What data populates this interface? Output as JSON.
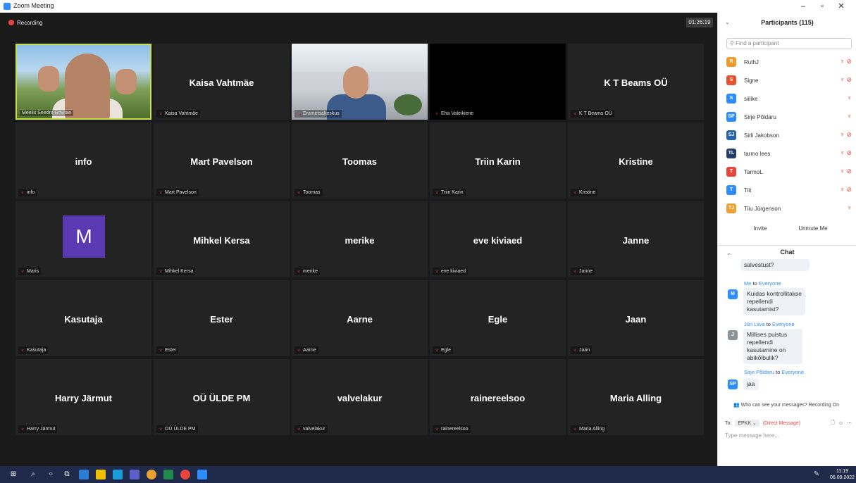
{
  "window": {
    "title": "Zoom Meeting"
  },
  "meeting": {
    "recording_label": "Recording",
    "timer": "01:26:19"
  },
  "tiles": [
    {
      "name": "",
      "label": "Meelis Seedre Brivitae",
      "kind": "video1"
    },
    {
      "name": "Kaisa Vahtmäe",
      "label": "Kaisa Vahtmäe",
      "kind": "name"
    },
    {
      "name": "",
      "label": "Erametsakeskus",
      "kind": "video2"
    },
    {
      "name": "",
      "label": "Eha Valeikiene",
      "kind": "black"
    },
    {
      "name": "K T Beams OÜ",
      "label": "K T Beams OÜ",
      "kind": "name"
    },
    {
      "name": "info",
      "label": "info",
      "kind": "name"
    },
    {
      "name": "Mart Pavelson",
      "label": "Mart Pavelson",
      "kind": "name"
    },
    {
      "name": "Toomas",
      "label": "Toomas",
      "kind": "name"
    },
    {
      "name": "Triin Karin",
      "label": "Triin Karin",
      "kind": "name"
    },
    {
      "name": "Kristine",
      "label": "Kristine",
      "kind": "name"
    },
    {
      "name": "M",
      "label": "Maris",
      "kind": "avatar"
    },
    {
      "name": "Mihkel Kersa",
      "label": "Mihkel Kersa",
      "kind": "name"
    },
    {
      "name": "merike",
      "label": "merike",
      "kind": "name"
    },
    {
      "name": "eve kiviaed",
      "label": "eve kiviaed",
      "kind": "name"
    },
    {
      "name": "Janne",
      "label": "Janne",
      "kind": "name"
    },
    {
      "name": "Kasutaja",
      "label": "Kasutaja",
      "kind": "name"
    },
    {
      "name": "Ester",
      "label": "Ester",
      "kind": "name"
    },
    {
      "name": "Aarne",
      "label": "Aarne",
      "kind": "name"
    },
    {
      "name": "Egle",
      "label": "Egle",
      "kind": "name"
    },
    {
      "name": "Jaan",
      "label": "Jaan",
      "kind": "name"
    },
    {
      "name": "Harry Järmut",
      "label": "Harry Järmut",
      "kind": "name"
    },
    {
      "name": "OÜ ÜLDE PM",
      "label": "OÜ ÜLDE PM",
      "kind": "name"
    },
    {
      "name": "valvelakur",
      "label": "valvelakur",
      "kind": "name"
    },
    {
      "name": "rainereelsoo",
      "label": "rainereelsoo",
      "kind": "name"
    },
    {
      "name": "Maria Alling",
      "label": "Maria Alling",
      "kind": "name"
    }
  ],
  "participants": {
    "title": "Participants (115)",
    "search_placeholder": "Find a participant",
    "list": [
      {
        "initials": "R",
        "name": "RuthJ",
        "color": "#f09a2a",
        "video_off": true
      },
      {
        "initials": "S",
        "name": "Signe",
        "color": "#e8512e",
        "video_off": true
      },
      {
        "initials": "S",
        "name": "siilike",
        "color": "#2d8cff",
        "video_off": false
      },
      {
        "initials": "SP",
        "name": "Sirje Põldaru",
        "color": "#2d8cff",
        "video_off": false
      },
      {
        "initials": "SJ",
        "name": "Sirli Jakobson",
        "color": "#2563b0",
        "video_off": true
      },
      {
        "initials": "TL",
        "name": "tarmo lees",
        "color": "#243b6b",
        "video_off": true
      },
      {
        "initials": "T",
        "name": "TarmoL",
        "color": "#e8453c",
        "video_off": true
      },
      {
        "initials": "T",
        "name": "Tiit",
        "color": "#2d8cff",
        "video_off": true
      },
      {
        "initials": "TJ",
        "name": "Tiiu Jürgenson",
        "color": "#f0a030",
        "video_off": false
      }
    ],
    "invite_label": "Invite",
    "unmute_label": "Unmute Me"
  },
  "chat": {
    "title": "Chat",
    "prev_message": "salvestust?",
    "messages": [
      {
        "from": "Me",
        "to": "Everyone",
        "initials": "M",
        "color": "#2d8cff",
        "text": "Kuidas kontrollitakse repellendi kasutamist?"
      },
      {
        "from": "Jüri Liiva",
        "to": "Everyone",
        "initials": "J",
        "color": "#8a9399",
        "text": "Millises puistus repellendi kasutamine on abikõlbulik?"
      },
      {
        "from": "Sirje Põldaru",
        "to": "Everyone",
        "initials": "SP",
        "color": "#2d8cff",
        "text": "jaa"
      }
    ],
    "to_word": "to",
    "info": "Who can see your messages? Recording On",
    "to_label": "To:",
    "recipient": "EPKK",
    "direct_message": "(Direct Message)",
    "input_placeholder": "Type message here..."
  },
  "taskbar": {
    "time": "11:19",
    "date": "06.09.2022"
  }
}
